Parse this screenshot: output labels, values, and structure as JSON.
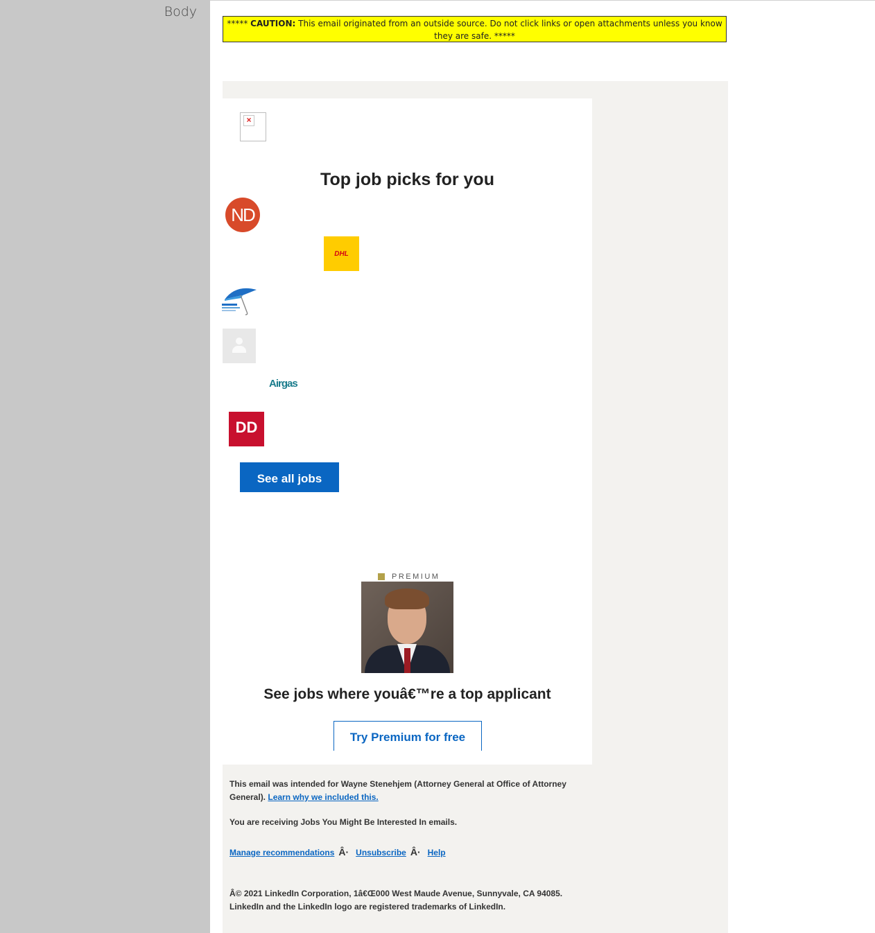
{
  "field": {
    "label": "Body"
  },
  "caution": {
    "prefix": "***** ",
    "bold": "CAUTION:",
    "text": " This email originated from an outside source. Do not click links or open attachments unless you know they are safe. *****"
  },
  "email": {
    "headline": "Top job picks for you",
    "companies": [
      {
        "name": "ND",
        "color": "#d84a2a"
      },
      {
        "name": "DHL",
        "color": "#ffcc00"
      },
      {
        "name": "umbrella"
      },
      {
        "name": "person"
      },
      {
        "name": "Airgas"
      },
      {
        "name": "DD"
      }
    ],
    "see_all_label": "See all jobs",
    "premium_badge": "PREMIUM",
    "premium_headline": "See jobs where youâ€™re a top applicant",
    "premium_button": "Try Premium for free",
    "footer": {
      "intended_text": "This email was intended for Wayne Stenehjem (Attorney General at Office of Attorney General).",
      "learn_link": "Learn why we included this.",
      "receiving": "You are receiving Jobs You Might Be Interested In emails.",
      "links": {
        "manage": "Manage recommendations",
        "sep": "Â·",
        "unsubscribe": "Unsubscribe",
        "help": "Help"
      },
      "copyright": "Â© 2021 LinkedIn Corporation, 1â€Œ000 West Maude Avenue, Sunnyvale, CA 94085. LinkedIn and the LinkedIn logo are registered trademarks of LinkedIn."
    }
  },
  "colors": {
    "caution_bg": "#ffff00",
    "brand_blue": "#0a66c2",
    "left_pane": "#c8c8c8",
    "email_bg": "#f3f2ef"
  }
}
